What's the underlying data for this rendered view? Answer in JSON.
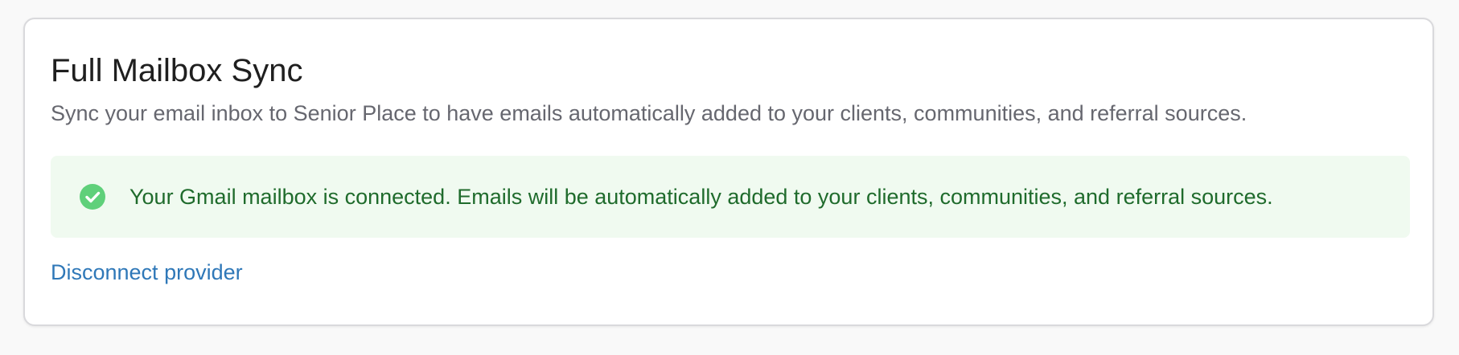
{
  "card": {
    "title": "Full Mailbox Sync",
    "description": "Sync your email inbox to Senior Place to have emails automatically added to your clients, communities, and referral sources."
  },
  "status": {
    "icon": "check-circle-icon",
    "message": "Your Gmail mailbox is connected. Emails will be automatically added to your clients, communities, and referral sources.",
    "color": "#1f6b2c",
    "background": "#f0faf0",
    "icon_color": "#5fd07a"
  },
  "actions": {
    "disconnect_label": "Disconnect provider",
    "link_color": "#2f78b8"
  }
}
